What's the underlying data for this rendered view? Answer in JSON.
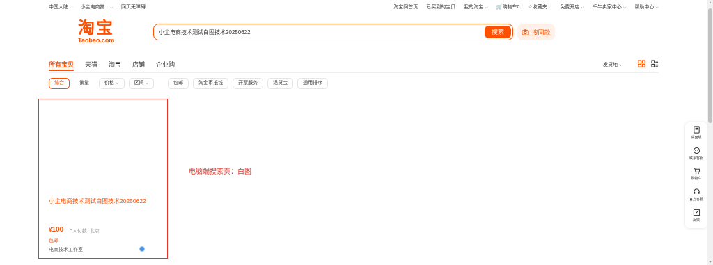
{
  "topbar": {
    "left": [
      "中国大陆",
      "小尘电商技...",
      "网页无障碍"
    ],
    "right": {
      "home": "淘宝网首页",
      "bought": "已买到的宝贝",
      "my": "我的淘宝",
      "cart": "购物车0",
      "fav": "收藏夹",
      "free": "免费开店",
      "seller": "千牛卖家中心",
      "help": "帮助中心"
    }
  },
  "logo": {
    "cn": "淘宝",
    "en": "Taobao.com"
  },
  "search": {
    "query": "小尘电商技术测试白图技术20250622",
    "button": "搜索",
    "photo": "搜同款"
  },
  "tabs": [
    "所有宝贝",
    "天猫",
    "淘宝",
    "店铺",
    "企业购"
  ],
  "shipfrom": "发货地",
  "filters": {
    "sort": [
      "综合",
      "销量",
      "价格",
      "区间"
    ],
    "options": [
      "包邮",
      "淘金币抵钱",
      "开票服务",
      "退货宝",
      "通用排序"
    ]
  },
  "product": {
    "title": "小尘电商技术测试白图技术20250622",
    "currency": "¥",
    "price": "100",
    "sales": "0人付款",
    "location": "北京",
    "shipping": "包邮",
    "shop": "电商技术工作室"
  },
  "annotation": "电脑端搜索页：白图",
  "sidebar": [
    "桌面版",
    "联系客服",
    "购物车",
    "官方客服",
    "反馈"
  ],
  "colors": {
    "accent": "#ff5000",
    "highlight": "#e9362b"
  }
}
